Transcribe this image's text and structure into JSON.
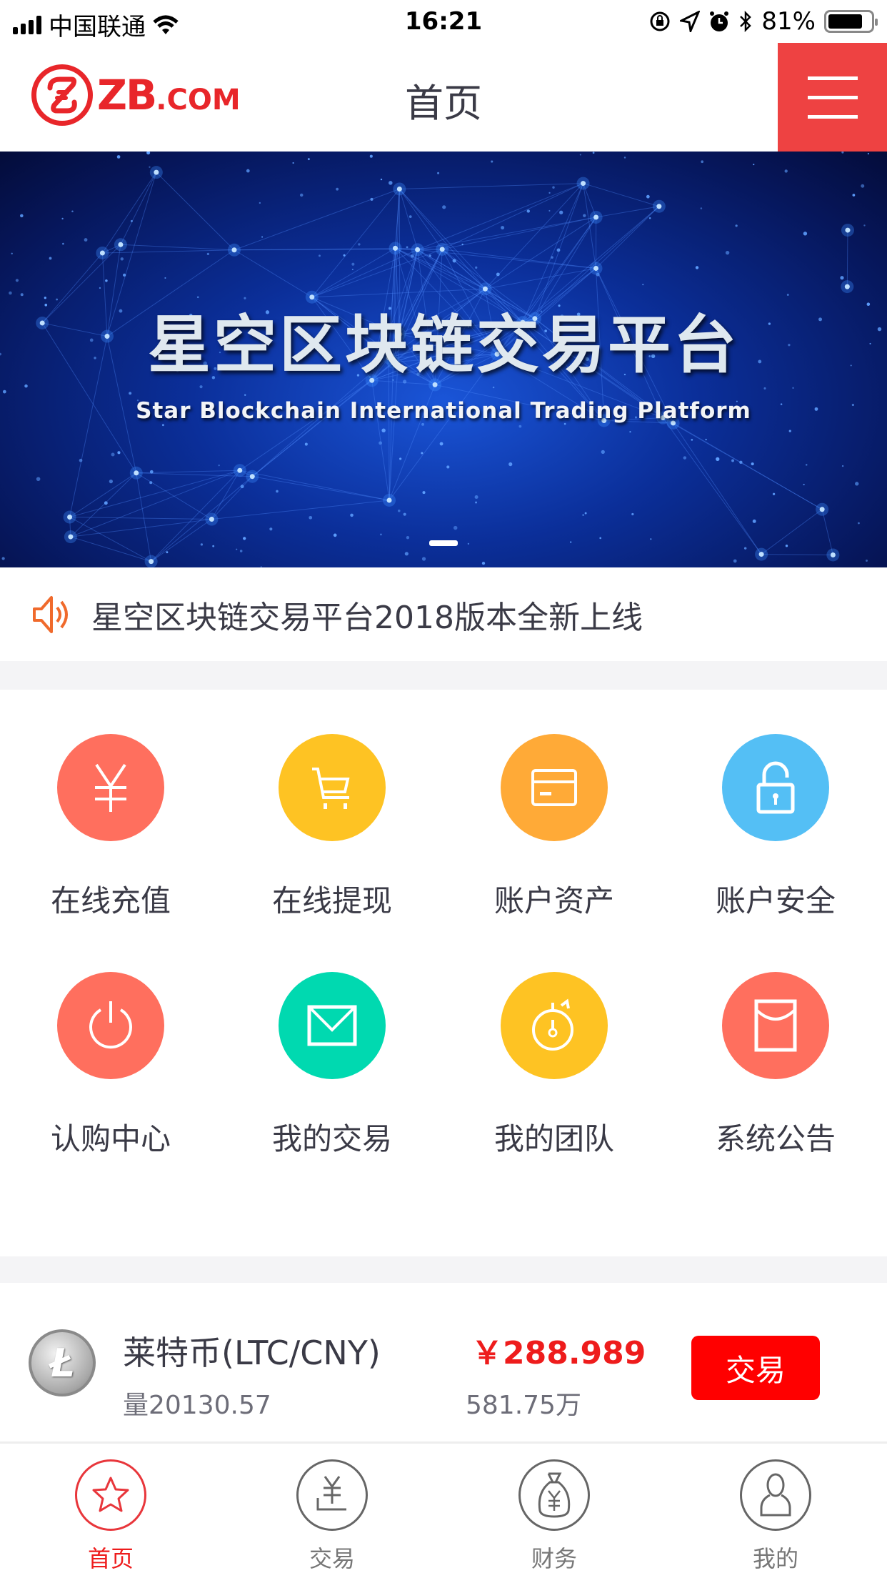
{
  "status_bar": {
    "carrier": "中国联通",
    "time": "16:21",
    "battery": "81%",
    "battery_level": 0.81
  },
  "header": {
    "logo_text": "ZB",
    "logo_suffix": ".COM",
    "title": "首页",
    "menu_icon": "hamburger-icon"
  },
  "banner": {
    "title": "星空区块链交易平台",
    "subtitle": "Star Blockchain International Trading Platform",
    "slide_count": 1,
    "active_slide": 0
  },
  "notice": {
    "icon": "speaker-icon",
    "text": "星空区块链交易平台2018版本全新上线"
  },
  "grid": {
    "items": [
      {
        "label": "在线充值",
        "icon": "yen-icon",
        "color": "#ff6f5e"
      },
      {
        "label": "在线提现",
        "icon": "cart-icon",
        "color": "#fec323"
      },
      {
        "label": "账户资产",
        "icon": "card-icon",
        "color": "#ffaa37"
      },
      {
        "label": "账户安全",
        "icon": "unlock-icon",
        "color": "#54bff5"
      },
      {
        "label": "认购中心",
        "icon": "power-icon",
        "color": "#ff6f5e"
      },
      {
        "label": "我的交易",
        "icon": "envelope-icon",
        "color": "#00d9b0"
      },
      {
        "label": "我的团队",
        "icon": "stopwatch-icon",
        "color": "#fec323"
      },
      {
        "label": "系统公告",
        "icon": "red-packet-icon",
        "color": "#ff6f5e"
      }
    ]
  },
  "market": {
    "coins": [
      {
        "name": "莱特币(LTC/CNY)",
        "logo_glyph": "Ł",
        "volume": "量20130.57",
        "price": "￥288.989",
        "amount": "581.75万",
        "action": "交易"
      }
    ]
  },
  "tabbar": {
    "items": [
      {
        "label": "首页",
        "icon": "star-icon",
        "active": true
      },
      {
        "label": "交易",
        "icon": "yen-coin-icon",
        "active": false
      },
      {
        "label": "财务",
        "icon": "money-bag-icon",
        "active": false
      },
      {
        "label": "我的",
        "icon": "user-icon",
        "active": false
      }
    ]
  },
  "colors": {
    "brand": "#e8262a",
    "menu_bg": "#ee4242",
    "price_red": "#ee1c1c",
    "trade_button": "#ff0000"
  }
}
